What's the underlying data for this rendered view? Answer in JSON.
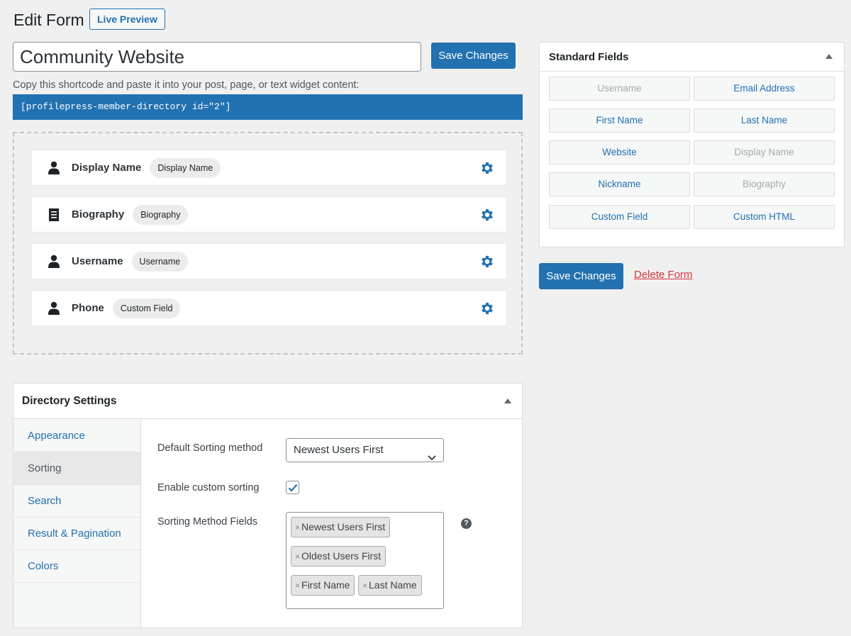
{
  "header": {
    "title": "Edit Form",
    "live_preview_label": "Live Preview"
  },
  "form": {
    "title_value": "Community Website",
    "save_label": "Save Changes",
    "shortcode_help": "Copy this shortcode and paste it into your post, page, or text widget content:",
    "shortcode": "[profilepress-member-directory id=\"2\"]"
  },
  "builder": {
    "fields": [
      {
        "name": "Display Name",
        "badge": "Display Name",
        "icon": "user-icon"
      },
      {
        "name": "Biography",
        "badge": "Biography",
        "icon": "document-icon"
      },
      {
        "name": "Username",
        "badge": "Username",
        "icon": "user-icon"
      },
      {
        "name": "Phone",
        "badge": "Custom Field",
        "icon": "user-icon"
      }
    ]
  },
  "standard_fields": {
    "title": "Standard Fields",
    "buttons": [
      {
        "label": "Username",
        "disabled": true
      },
      {
        "label": "Email Address",
        "disabled": false
      },
      {
        "label": "First Name",
        "disabled": false
      },
      {
        "label": "Last Name",
        "disabled": false
      },
      {
        "label": "Website",
        "disabled": false
      },
      {
        "label": "Display Name",
        "disabled": true
      },
      {
        "label": "Nickname",
        "disabled": false
      },
      {
        "label": "Biography",
        "disabled": true
      },
      {
        "label": "Custom Field",
        "disabled": false
      },
      {
        "label": "Custom HTML",
        "disabled": false
      }
    ]
  },
  "sidebar_actions": {
    "save_label": "Save Changes",
    "delete_label": "Delete Form"
  },
  "directory_settings": {
    "title": "Directory Settings",
    "nav": [
      {
        "label": "Appearance",
        "active": false
      },
      {
        "label": "Sorting",
        "active": true
      },
      {
        "label": "Search",
        "active": false
      },
      {
        "label": "Result & Pagination",
        "active": false
      },
      {
        "label": "Colors",
        "active": false
      }
    ],
    "default_sorting_label": "Default Sorting method",
    "default_sorting_value": "Newest Users First",
    "custom_sorting_label": "Enable custom sorting",
    "custom_sorting_checked": true,
    "sorting_fields_label": "Sorting Method Fields",
    "sorting_fields": [
      "Newest Users First",
      "Oldest Users First",
      "First Name",
      "Last Name"
    ],
    "help_glyph": "?"
  },
  "colors": {
    "accent": "#2271b1",
    "danger": "#d63638",
    "background": "#f0f0f1"
  }
}
